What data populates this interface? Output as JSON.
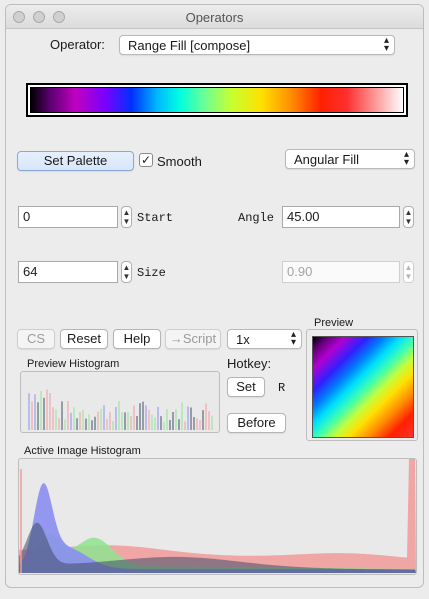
{
  "window": {
    "title": "Operators"
  },
  "operator": {
    "label": "Operator:",
    "selected": "Range Fill [compose]"
  },
  "palette": {
    "set_label": "Set Palette",
    "smooth_label": "Smooth",
    "smooth_checked": true,
    "fill_mode": "Angular Fill"
  },
  "fields": {
    "start": {
      "value": "0",
      "label": "Start"
    },
    "size": {
      "value": "64",
      "label": "Size"
    },
    "angle": {
      "value": "45.00",
      "label": "Angle"
    },
    "disabled_value": "0.90"
  },
  "buttons": {
    "cs": "CS",
    "reset": "Reset",
    "help": "Help",
    "script": "→Script",
    "zoom": "1x"
  },
  "hotkey": {
    "label": "Hotkey:",
    "set": "Set",
    "key": "R",
    "before": "Before"
  },
  "preview": {
    "label": "Preview"
  },
  "preview_histogram": {
    "label": "Preview Histogram"
  },
  "active_histogram": {
    "label": "Active Image Histogram"
  },
  "colors": {
    "hist_blue": "#8a8ef0",
    "hist_green": "#8fe38f",
    "hist_red": "#f29a9a",
    "hist_dark": "#3f4f68"
  }
}
